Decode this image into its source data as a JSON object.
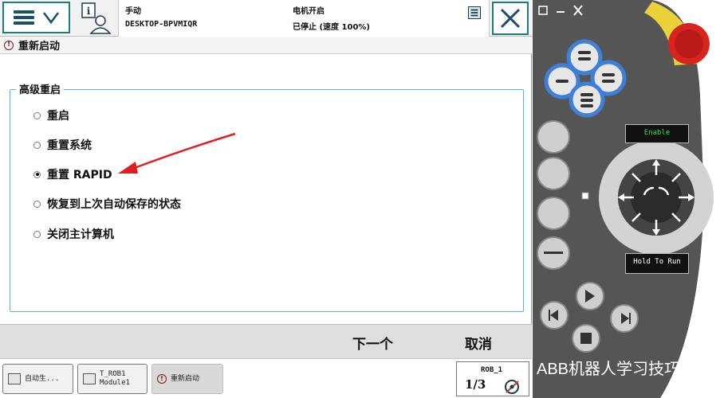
{
  "topbar": {
    "mode": "手动",
    "host": "DESKTOP-BPVMIQR",
    "motor": "电机开启",
    "state": "已停止 (速度 100%)"
  },
  "page": {
    "title": "重新启动",
    "group_label": "高级重启",
    "options": [
      {
        "label": "重启",
        "selected": false
      },
      {
        "label": "重置系统",
        "selected": false
      },
      {
        "label": "重置 RAPID",
        "selected": true
      },
      {
        "label": "恢复到上次自动保存的状态",
        "selected": false
      },
      {
        "label": "关闭主计算机",
        "selected": false
      }
    ]
  },
  "actions": {
    "next": "下一个",
    "cancel": "取消"
  },
  "taskbar": {
    "task1": "自动生...",
    "task2": "T_ROB1\nModule1",
    "task3": "重新启动",
    "rob_name": "ROB_1",
    "rob_fraction": "1/3"
  },
  "pendant": {
    "enable_label": "Enable",
    "hold_label": "Hold To Run"
  },
  "caption": "ABB机器人学习技巧",
  "colors": {
    "accent": "#1a7d7b",
    "group_border": "#58b8c6",
    "pendant_body": "#555555",
    "pendant_blue": "#3f7fd8",
    "estop_red": "#d8231f",
    "estop_yellow": "#ecd23a",
    "arrow_red": "#e02020"
  }
}
